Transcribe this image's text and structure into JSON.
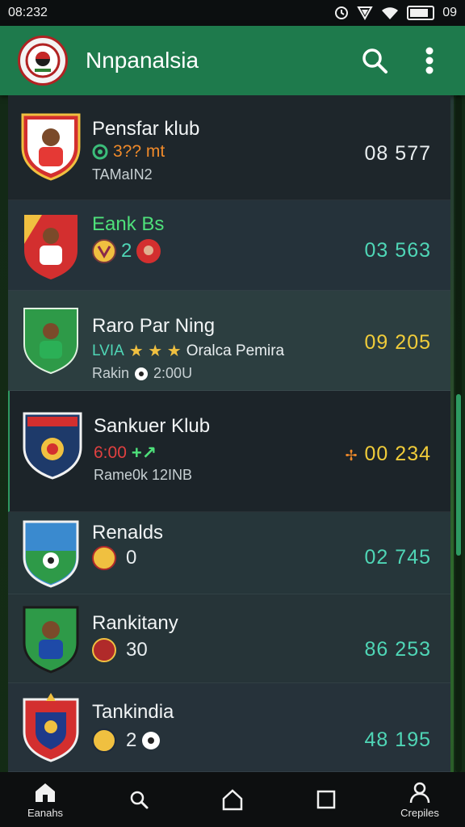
{
  "status_bar": {
    "time": "08:232",
    "battery_text": "09"
  },
  "app_bar": {
    "title": "Nnpanalsia"
  },
  "colors": {
    "app_bar": "#1e7a4c",
    "score_white": "#e9eef0",
    "score_teal": "#4fd6b6",
    "score_yellow": "#f0cc3a",
    "score_orange": "#f08a2a"
  },
  "clubs": [
    {
      "name": "Pensfar klub",
      "sub": "3?? mt",
      "sub2": "TAMaIN2",
      "score": "08 577"
    },
    {
      "name": "Eank Bs",
      "sub": "2",
      "score": "03 563"
    },
    {
      "name": "Raro Par Ning",
      "sub": "LVIA",
      "sub_extra": "Oralca Pemira",
      "sub2": "Rakin",
      "sub2_extra": "2:00U",
      "score": "09 205"
    },
    {
      "name": "Sankuer Klub",
      "sub": "6:00",
      "sub2": "Rame0k 12INB",
      "score": "00 234"
    },
    {
      "name": "Renalds",
      "sub": "0",
      "score": "02 745"
    },
    {
      "name": "Rankitany",
      "sub": "30",
      "score": "86 253"
    },
    {
      "name": "Tankindia",
      "sub": "2",
      "score": "48 195"
    }
  ],
  "bottom_nav": [
    {
      "label": "Eanahs",
      "icon": "home-icon"
    },
    {
      "label": "",
      "icon": "search-icon"
    },
    {
      "label": "",
      "icon": "android-home-icon"
    },
    {
      "label": "",
      "icon": "recents-icon"
    },
    {
      "label": "Crepiles",
      "icon": "profile-icon"
    }
  ]
}
